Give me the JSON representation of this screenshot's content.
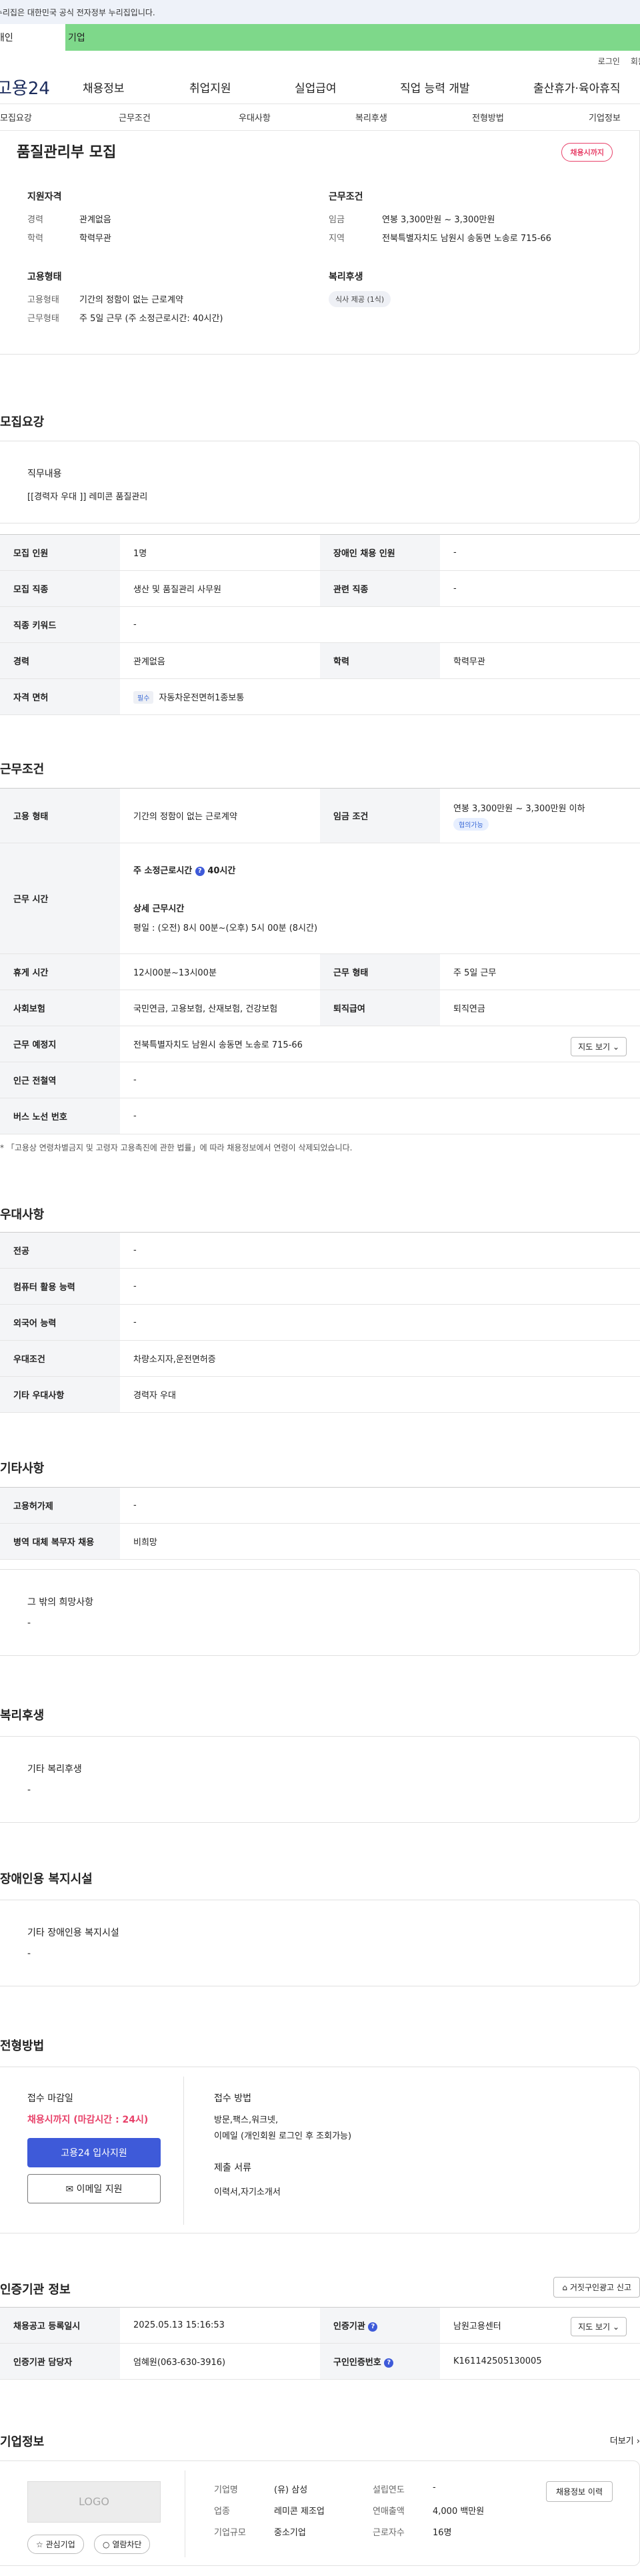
{
  "banner": {
    "text": "이 누리집은 대한민국 공식 전자정부 누리집입니다."
  },
  "tabs": {
    "individual": "개인",
    "corporate": "기업"
  },
  "topmenu": {
    "login": "로그인",
    "signup": "회원가입"
  },
  "gnb": {
    "logo": "고용24",
    "items": [
      "채용정보",
      "취업지원",
      "실업급여",
      "직업 능력 개발",
      "출산휴가·육아휴직"
    ]
  },
  "subnav": [
    "모집요강",
    "근무조건",
    "우대사항",
    "복리후생",
    "전형방법",
    "기업정보"
  ],
  "summary": {
    "title": "품질관리부 모집",
    "badge": "채용시까지",
    "qual_h": "지원자격",
    "qual": [
      {
        "k": "경력",
        "v": "관계없음"
      },
      {
        "k": "학력",
        "v": "학력무관"
      }
    ],
    "cond_h": "근무조건",
    "cond": [
      {
        "k": "임금",
        "v": "연봉 3,300만원 ~ 3,300만원"
      },
      {
        "k": "지역",
        "v": "전북특별자치도 남원시 송동면 노송로 715-66"
      }
    ],
    "emp_h": "고용형태",
    "emp": [
      {
        "k": "고용형태",
        "v": "기간의 정함이 없는 근로계약"
      },
      {
        "k": "근무형태",
        "v": "주 5일 근무 (주 소정근로시간: 40시간)"
      }
    ],
    "welfare_h": "복리후생",
    "welfare_tag": "식사 제공 (1식)"
  },
  "recruit": {
    "title": "모집요강",
    "duty_h": "직무내용",
    "duty": "[[경력자 우대 ]]   레미콘 품질관리",
    "rows": [
      {
        "k1": "모집 인원",
        "v1": "1명",
        "k2": "장애인 채용 인원",
        "v2": "-"
      },
      {
        "k1": "모집 직종",
        "v1": "생산 및 품질관리 사무원",
        "k2": "관련 직종",
        "v2": "-"
      },
      {
        "k1": "직종 키워드",
        "v1": "-"
      },
      {
        "k1": "경력",
        "v1": "관계없음",
        "k2": "학력",
        "v2": "학력무관"
      },
      {
        "k1": "자격 면허",
        "chip": "필수",
        "v1": "자동차운전면허1종보통"
      }
    ]
  },
  "work": {
    "title": "근무조건",
    "emp_k": "고용 형태",
    "emp_v": "기간의 정함이 없는 근로계약",
    "wage_k": "임금 조건",
    "wage_v": "연봉 3,300만원 ~ 3,300만원 이하",
    "wage_tag": "협의가능",
    "time_k": "근무 시간",
    "time_l1": "주 소정근로시간",
    "time_l1v": "40시간",
    "time_l2": "상세 근무시간",
    "time_l3": "평일 : (오전) 8시 00분~(오후) 5시 00분 (8시간)",
    "rest_k": "휴게 시간",
    "rest_v": "12시00분~13시00분",
    "form_k": "근무 형태",
    "form_v": "주 5일 근무",
    "ins_k": "사회보험",
    "ins_v": "국민연금, 고용보험, 산재보험, 건강보험",
    "ret_k": "퇴직급여",
    "ret_v": "퇴직연금",
    "place_k": "근무 예정지",
    "place_v": "전북특별자치도 남원시 송동면 노송로 715-66",
    "map_btn": "지도 보기",
    "sta_k": "인근 전철역",
    "sta_v": "-",
    "bus_k": "버스 노선 번호",
    "bus_v": "-",
    "note": "* 「고용상 연령차별금지 및 고령자 고용촉진에 관한 법률」에 따라 채용정보에서 연령이 삭제되었습니다."
  },
  "pref": {
    "title": "우대사항",
    "rows": [
      {
        "k": "전공",
        "v": "-"
      },
      {
        "k": "컴퓨터 활용 능력",
        "v": "-"
      },
      {
        "k": "외국어 능력",
        "v": "-"
      },
      {
        "k": "우대조건",
        "v": "차량소지자,운전면허증"
      },
      {
        "k": "기타 우대사항",
        "v": "경력자 우대"
      }
    ]
  },
  "etc": {
    "title": "기타사항",
    "rows": [
      {
        "k": "고용허가제",
        "v": "-"
      },
      {
        "k": "병역 대체 복무자 채용",
        "v": "비희망"
      }
    ],
    "other_h": "그 밖의 희망사항",
    "other_v": "-"
  },
  "welfare": {
    "title": "복리후생",
    "h": "기타 복리후생",
    "v": "-"
  },
  "disabled": {
    "title": "장애인용 복지시설",
    "h": "기타 장애인용 복지시설",
    "v": "-"
  },
  "process": {
    "title": "전형방법",
    "deadline_h": "접수 마감일",
    "deadline_v": "채용시까지 (마감시간 : 24시)",
    "apply_btn": "고용24 입사지원",
    "email_btn": "이메일 지원",
    "method_h": "접수 방법",
    "method_v1": "방문,팩스,워크넷,",
    "method_v2": "이메일 (개인회원 로그인 후 조회가능)",
    "docs_h": "제출 서류",
    "docs_v": "이력서,자기소개서"
  },
  "cert": {
    "title": "인증기관 정보",
    "report_btn": "거짓구인광고 신고",
    "r1k1": "채용공고 등록일시",
    "r1v1": "2025.05.13 15:16:53",
    "r1k2": "인증기관",
    "r1v2": "남원고용센터",
    "map_btn": "지도 보기",
    "r2k1": "인증기관 담당자",
    "r2v1": "엄혜원(063-630-3916)",
    "r2k2": "구인인증번호",
    "r2v2": "K161142505130005"
  },
  "company": {
    "title": "기업정보",
    "more": "더보기",
    "logo": "LOGO",
    "fav_btn": "관심기업",
    "alert_btn": "열람차단",
    "hist_btn": "채용정보 이력",
    "f": [
      {
        "k": "기업명",
        "v": "(유) 삼성"
      },
      {
        "k": "업종",
        "v": "레미콘 제조업"
      },
      {
        "k": "기업규모",
        "v": "중소기업"
      }
    ],
    "g": [
      {
        "k": "설립연도",
        "v": "-"
      },
      {
        "k": "연매출액",
        "v": "4,000 백만원"
      },
      {
        "k": "근로자수",
        "v": "16명"
      }
    ]
  }
}
